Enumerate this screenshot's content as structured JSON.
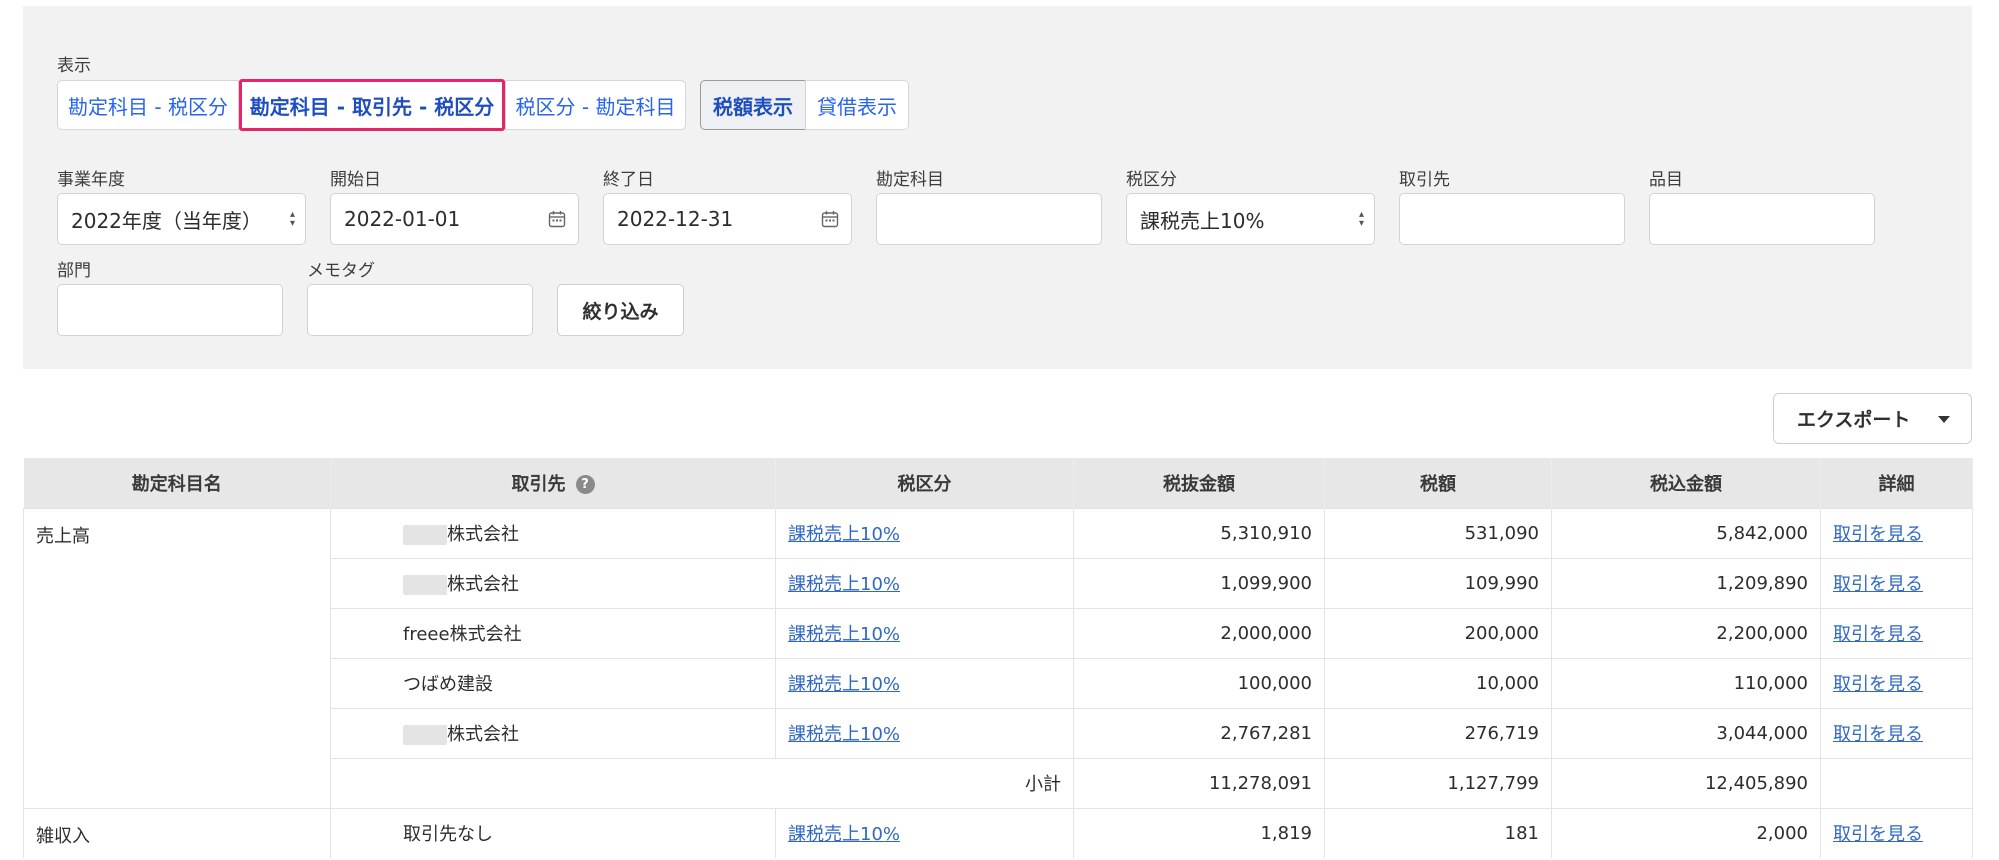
{
  "filters": {
    "display_label": "表示",
    "view_tabs": [
      {
        "label": "勘定科目 - 税区分"
      },
      {
        "label": "勘定科目 - 取引先 - 税区分"
      },
      {
        "label": "税区分 - 勘定科目"
      }
    ],
    "amount_tabs": [
      {
        "label": "税額表示"
      },
      {
        "label": "貸借表示"
      }
    ],
    "fiscal_year": {
      "label": "事業年度",
      "value": "2022年度（当年度）"
    },
    "start_date": {
      "label": "開始日",
      "value": "2022-01-01"
    },
    "end_date": {
      "label": "終了日",
      "value": "2022-12-31"
    },
    "account": {
      "label": "勘定科目",
      "value": ""
    },
    "tax_category": {
      "label": "税区分",
      "value": "課税売上10%"
    },
    "partner": {
      "label": "取引先",
      "value": ""
    },
    "item": {
      "label": "品目",
      "value": ""
    },
    "department": {
      "label": "部門",
      "value": ""
    },
    "memo_tag": {
      "label": "メモタグ",
      "value": ""
    },
    "filter_button": "絞り込み"
  },
  "export_button": "エクスポート",
  "colors": {
    "link": "#3168c4",
    "highlight_border": "#e6246b",
    "panel_bg": "#f2f2f2",
    "header_bg": "#e7e7e7"
  },
  "table": {
    "headers": [
      "勘定科目名",
      "取引先",
      "税区分",
      "税抜金額",
      "税額",
      "税込金額",
      "詳細"
    ],
    "help_icon": "question-circle-icon",
    "groups": [
      {
        "account": "売上高",
        "rows": [
          {
            "partner": "株式会社",
            "partner_masked": true,
            "tax": "課税売上10%",
            "net": "5,310,910",
            "tax_amount": "531,090",
            "gross": "5,842,000",
            "detail": "取引を見る"
          },
          {
            "partner": "株式会社",
            "partner_masked": true,
            "tax": "課税売上10%",
            "net": "1,099,900",
            "tax_amount": "109,990",
            "gross": "1,209,890",
            "detail": "取引を見る"
          },
          {
            "partner": "freee株式会社",
            "partner_masked": false,
            "tax": "課税売上10%",
            "net": "2,000,000",
            "tax_amount": "200,000",
            "gross": "2,200,000",
            "detail": "取引を見る"
          },
          {
            "partner": "つばめ建設",
            "partner_masked": false,
            "tax": "課税売上10%",
            "net": "100,000",
            "tax_amount": "10,000",
            "gross": "110,000",
            "detail": "取引を見る"
          },
          {
            "partner": "株式会社",
            "partner_masked": true,
            "tax": "課税売上10%",
            "net": "2,767,281",
            "tax_amount": "276,719",
            "gross": "3,044,000",
            "detail": "取引を見る"
          }
        ],
        "subtotal": {
          "label": "小計",
          "net": "11,278,091",
          "tax_amount": "1,127,799",
          "gross": "12,405,890"
        }
      },
      {
        "account": "雑収入",
        "rows": [
          {
            "partner": "取引先なし",
            "partner_masked": false,
            "tax": "課税売上10%",
            "net": "1,819",
            "tax_amount": "181",
            "gross": "2,000",
            "detail": "取引を見る"
          }
        ]
      }
    ]
  }
}
